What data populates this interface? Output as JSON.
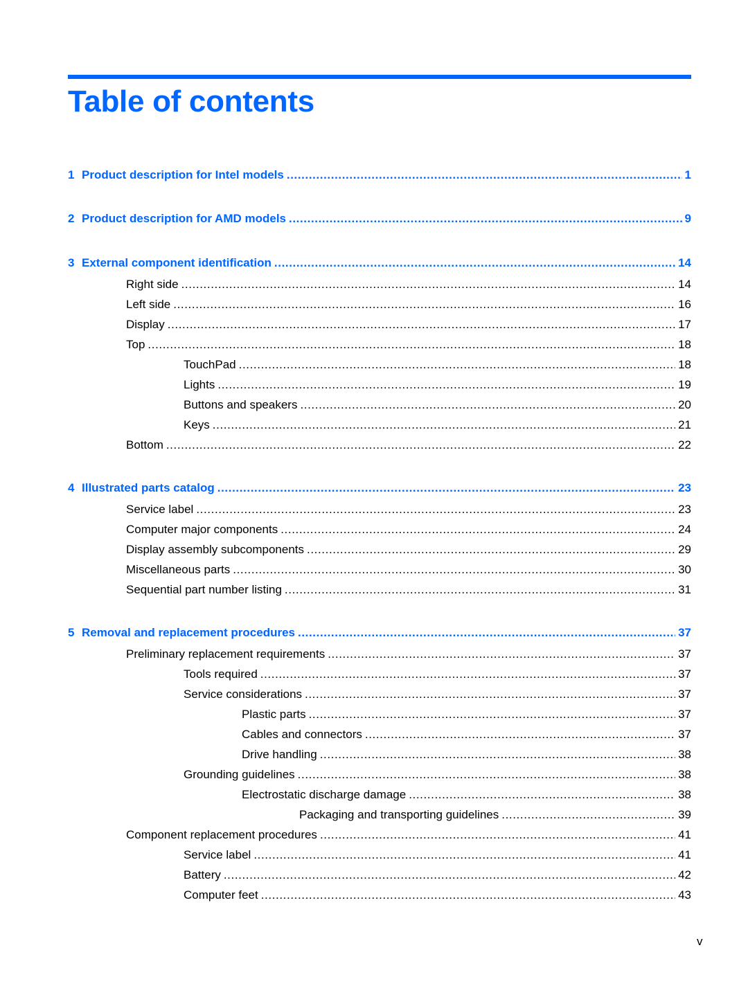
{
  "title": "Table of contents",
  "accent_color": "#0066ff",
  "page_number": "v",
  "entries": [
    {
      "num": "1",
      "label": "Product description for Intel models",
      "page": "1",
      "level": 0
    },
    {
      "num": "2",
      "label": "Product description for AMD models",
      "page": "9",
      "level": 0
    },
    {
      "num": "3",
      "label": "External component identification",
      "page": "14",
      "level": 0
    },
    {
      "label": "Right side",
      "page": "14",
      "level": 1
    },
    {
      "label": "Left side",
      "page": "16",
      "level": 1
    },
    {
      "label": "Display",
      "page": "17",
      "level": 1
    },
    {
      "label": "Top",
      "page": "18",
      "level": 1
    },
    {
      "label": "TouchPad",
      "page": "18",
      "level": 2
    },
    {
      "label": "Lights",
      "page": "19",
      "level": 2
    },
    {
      "label": "Buttons and speakers",
      "page": "20",
      "level": 2
    },
    {
      "label": "Keys",
      "page": "21",
      "level": 2
    },
    {
      "label": "Bottom",
      "page": "22",
      "level": 1
    },
    {
      "num": "4",
      "label": "Illustrated parts catalog",
      "page": "23",
      "level": 0
    },
    {
      "label": "Service label",
      "page": "23",
      "level": 1
    },
    {
      "label": "Computer major components",
      "page": "24",
      "level": 1
    },
    {
      "label": "Display assembly subcomponents",
      "page": "29",
      "level": 1
    },
    {
      "label": "Miscellaneous parts",
      "page": "30",
      "level": 1
    },
    {
      "label": "Sequential part number listing",
      "page": "31",
      "level": 1
    },
    {
      "num": "5",
      "label": "Removal and replacement procedures",
      "page": "37",
      "level": 0
    },
    {
      "label": "Preliminary replacement requirements",
      "page": "37",
      "level": 1
    },
    {
      "label": "Tools required",
      "page": "37",
      "level": 2
    },
    {
      "label": "Service considerations",
      "page": "37",
      "level": 2
    },
    {
      "label": "Plastic parts",
      "page": "37",
      "level": 3
    },
    {
      "label": "Cables and connectors",
      "page": "37",
      "level": 3
    },
    {
      "label": "Drive handling",
      "page": "38",
      "level": 3
    },
    {
      "label": "Grounding guidelines",
      "page": "38",
      "level": 2
    },
    {
      "label": "Electrostatic discharge damage",
      "page": "38",
      "level": 3
    },
    {
      "label": "Packaging and transporting guidelines",
      "page": "39",
      "level": 4
    },
    {
      "label": "Component replacement procedures",
      "page": "41",
      "level": 1
    },
    {
      "label": "Service label",
      "page": "41",
      "level": 2
    },
    {
      "label": "Battery",
      "page": "42",
      "level": 2
    },
    {
      "label": "Computer feet",
      "page": "43",
      "level": 2
    }
  ]
}
